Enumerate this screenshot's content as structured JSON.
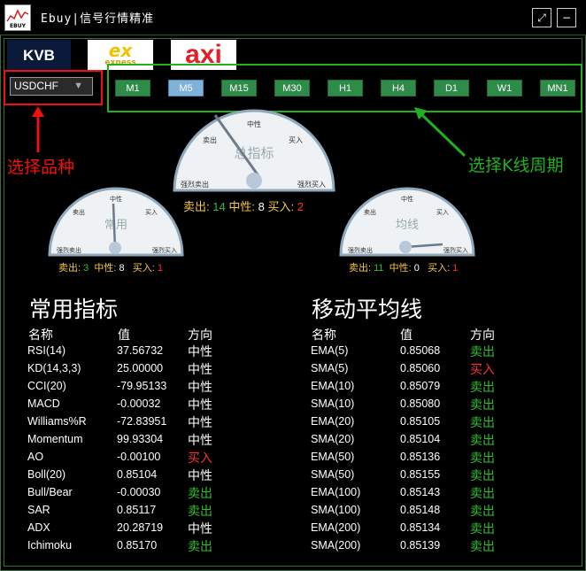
{
  "app": {
    "title": "Ebuy|信号行情精准",
    "logo_text": "EBUY"
  },
  "window_buttons": {
    "restore": "⤢",
    "minimize": "−"
  },
  "brokers": [
    "KVB",
    "exness",
    "axi"
  ],
  "symbol": {
    "value": "USDCHF"
  },
  "timeframes": [
    "M1",
    "M5",
    "M15",
    "M30",
    "H1",
    "H4",
    "D1",
    "W1",
    "MN1"
  ],
  "active_timeframe": "M5",
  "annotations": {
    "symbol_hint": "选择品种",
    "period_hint": "选择K线周期"
  },
  "gauges": {
    "total": {
      "title": "总指标",
      "sell_label": "卖出:",
      "sell": "14",
      "neutral_label": "中性:",
      "neutral": "8",
      "buy_label": "买入:",
      "buy": "2",
      "ticks": {
        "neutral": "中性",
        "sell": "卖出",
        "buy": "买入",
        "strong_sell": "强烈卖出",
        "strong_buy": "强烈买入"
      }
    },
    "common": {
      "title": "常用",
      "sell_label": "卖出:",
      "sell": "3",
      "neutral_label": "中性:",
      "neutral": "8",
      "buy_label": "买入:",
      "buy": "1",
      "ticks": {
        "neutral": "中性",
        "sell": "卖出",
        "buy": "买入",
        "strong_sell": "强烈卖出",
        "strong_buy": "强烈买入"
      }
    },
    "ma": {
      "title": "均线",
      "sell_label": "卖出:",
      "sell": "11",
      "neutral_label": "中性:",
      "neutral": "0",
      "buy_label": "买入:",
      "buy": "1",
      "ticks": {
        "neutral": "中性",
        "sell": "卖出",
        "buy": "买入",
        "strong_sell": "强烈卖出",
        "strong_buy": "强烈买入"
      }
    }
  },
  "common_indicators": {
    "title": "常用指标",
    "headers": {
      "name": "名称",
      "value": "值",
      "direction": "方向"
    },
    "rows": [
      {
        "name": "RSI(14)",
        "value": "37.56732",
        "direction": "中性",
        "kind": "neutral"
      },
      {
        "name": "KD(14,3,3)",
        "value": "25.00000",
        "direction": "中性",
        "kind": "neutral"
      },
      {
        "name": "CCI(20)",
        "value": "-79.95133",
        "direction": "中性",
        "kind": "neutral"
      },
      {
        "name": "MACD",
        "value": "-0.00032",
        "direction": "中性",
        "kind": "neutral"
      },
      {
        "name": "Williams%R",
        "value": "-72.83951",
        "direction": "中性",
        "kind": "neutral"
      },
      {
        "name": "Momentum",
        "value": "99.93304",
        "direction": "中性",
        "kind": "neutral"
      },
      {
        "name": "AO",
        "value": "-0.00100",
        "direction": "买入",
        "kind": "buy"
      },
      {
        "name": "Boll(20)",
        "value": "0.85104",
        "direction": "中性",
        "kind": "neutral"
      },
      {
        "name": "Bull/Bear",
        "value": "-0.00030",
        "direction": "卖出",
        "kind": "sell"
      },
      {
        "name": "SAR",
        "value": "0.85117",
        "direction": "卖出",
        "kind": "sell"
      },
      {
        "name": "ADX",
        "value": "20.28719",
        "direction": "中性",
        "kind": "neutral"
      },
      {
        "name": "Ichimoku",
        "value": "0.85170",
        "direction": "卖出",
        "kind": "sell"
      }
    ]
  },
  "moving_averages": {
    "title": "移动平均线",
    "headers": {
      "name": "名称",
      "value": "值",
      "direction": "方向"
    },
    "rows": [
      {
        "name": "EMA(5)",
        "value": "0.85068",
        "direction": "卖出",
        "kind": "sell"
      },
      {
        "name": "SMA(5)",
        "value": "0.85060",
        "direction": "买入",
        "kind": "buy"
      },
      {
        "name": "EMA(10)",
        "value": "0.85079",
        "direction": "卖出",
        "kind": "sell"
      },
      {
        "name": "SMA(10)",
        "value": "0.85080",
        "direction": "卖出",
        "kind": "sell"
      },
      {
        "name": "EMA(20)",
        "value": "0.85105",
        "direction": "卖出",
        "kind": "sell"
      },
      {
        "name": "SMA(20)",
        "value": "0.85104",
        "direction": "卖出",
        "kind": "sell"
      },
      {
        "name": "EMA(50)",
        "value": "0.85136",
        "direction": "卖出",
        "kind": "sell"
      },
      {
        "name": "SMA(50)",
        "value": "0.85155",
        "direction": "卖出",
        "kind": "sell"
      },
      {
        "name": "EMA(100)",
        "value": "0.85143",
        "direction": "卖出",
        "kind": "sell"
      },
      {
        "name": "SMA(100)",
        "value": "0.85148",
        "direction": "卖出",
        "kind": "sell"
      },
      {
        "name": "EMA(200)",
        "value": "0.85134",
        "direction": "卖出",
        "kind": "sell"
      },
      {
        "name": "SMA(200)",
        "value": "0.85139",
        "direction": "卖出",
        "kind": "sell"
      }
    ]
  },
  "colors": {
    "sell": "#2fbf2f",
    "buy": "#ff3030",
    "neutral": "#ffffff",
    "label": "#f5c842",
    "symbol_box": "#f01010",
    "period_box": "#22b022"
  }
}
